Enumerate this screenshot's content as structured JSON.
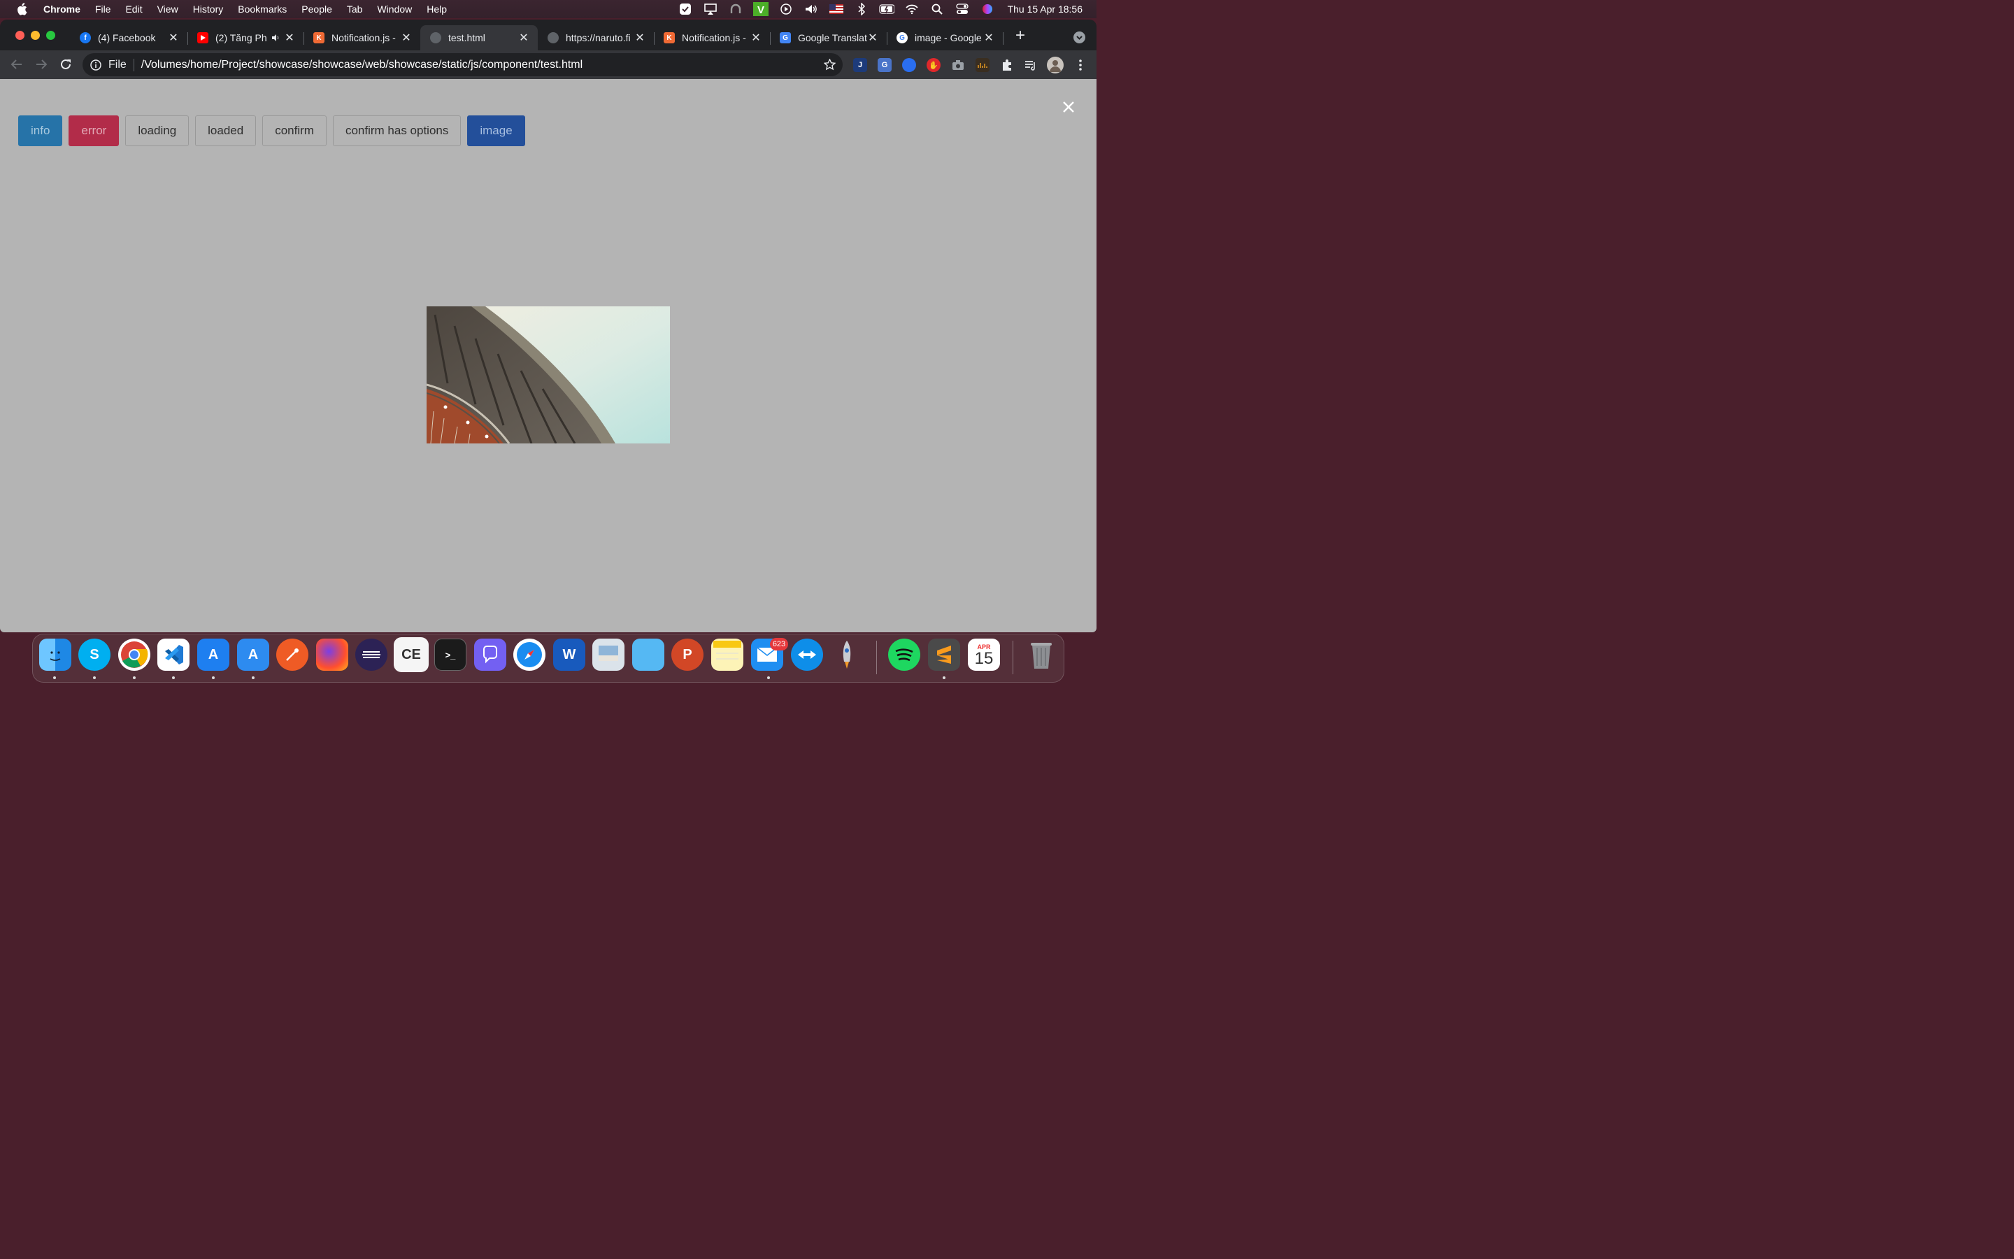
{
  "menubar": {
    "app_name": "Chrome",
    "menus": [
      "File",
      "Edit",
      "View",
      "History",
      "Bookmarks",
      "People",
      "Tab",
      "Window",
      "Help"
    ],
    "clock": "Thu 15 Apr  18:56",
    "tray_icons": [
      "checkmark-icon",
      "airplay-icon",
      "headphones-icon",
      "v-app-icon",
      "play-icon",
      "volume-icon",
      "us-flag-icon",
      "bluetooth-icon",
      "battery-icon",
      "wifi-icon",
      "search-icon",
      "control-center-icon",
      "siri-icon"
    ]
  },
  "tabs": [
    {
      "title": "(4) Facebook",
      "icon": "facebook-icon",
      "color": "#1877f2"
    },
    {
      "title": "(2) Tăng Ph",
      "icon": "youtube-icon",
      "color": "#ff0000",
      "audio": true
    },
    {
      "title": "Notification.js -",
      "icon": "notificationjs-icon",
      "color": "#f06a35"
    },
    {
      "title": "test.html",
      "icon": "globe-icon",
      "color": "#5f6368",
      "active": true
    },
    {
      "title": "https://naruto.fi",
      "icon": "globe-icon",
      "color": "#5f6368"
    },
    {
      "title": "Notification.js -",
      "icon": "notificationjs-icon",
      "color": "#f06a35"
    },
    {
      "title": "Google Translat",
      "icon": "google-translate-icon",
      "color": "#4285f4"
    },
    {
      "title": "image - Google",
      "icon": "google-icon",
      "color": "#ffffff"
    }
  ],
  "omnibox": {
    "scheme": "File",
    "url": "/Volumes/home/Project/showcase/showcase/web/showcase/static/js/component/test.html"
  },
  "extensions": [
    "j-extension-icon",
    "translate-extension-icon",
    "vpn-extension-icon",
    "adblock-extension-icon",
    "camera-extension-icon",
    "dark-extension-icon",
    "puzzle-icon",
    "reading-list-icon",
    "avatar",
    "more-icon"
  ],
  "page": {
    "buttons": [
      {
        "label": "info",
        "style": "info"
      },
      {
        "label": "error",
        "style": "error"
      },
      {
        "label": "loading",
        "style": "def"
      },
      {
        "label": "loaded",
        "style": "def"
      },
      {
        "label": "confirm",
        "style": "def"
      },
      {
        "label": "confirm has options",
        "style": "def"
      },
      {
        "label": "image",
        "style": "primary"
      }
    ],
    "overlay_color": "#b4b4b4"
  },
  "dock": {
    "apps": [
      "Finder",
      "Skype",
      "Chrome",
      "VS Code",
      "Xcode",
      "Xcode Beta",
      "Postman",
      "Firefox",
      "Eclipse",
      "Cheat Engine",
      "Terminal",
      "Viber",
      "Safari",
      "Word",
      "Preview",
      "Files",
      "PowerPoint",
      "Notes",
      "Mail",
      "TeamViewer",
      "Rocket",
      "Spotify",
      "Sublime Text",
      "Calendar",
      "Trash"
    ],
    "mail_badge": "623",
    "calendar_month": "APR",
    "calendar_day": "15"
  }
}
